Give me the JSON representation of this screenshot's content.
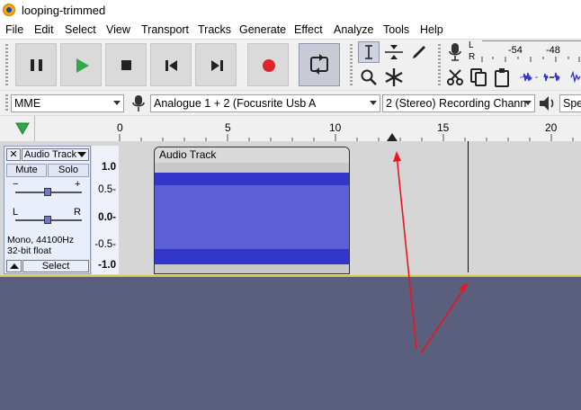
{
  "window": {
    "title": "looping-trimmed"
  },
  "menu": [
    "File",
    "Edit",
    "Select",
    "View",
    "Transport",
    "Tracks",
    "Generate",
    "Effect",
    "Analyze",
    "Tools",
    "Help"
  ],
  "meter": {
    "channels": [
      "L",
      "R"
    ],
    "scale": [
      "-54",
      "-48"
    ]
  },
  "device": {
    "host": "MME",
    "recording_device": "Analogue 1 + 2 (Focusrite Usb A",
    "recording_channels": "2 (Stereo) Recording Chann",
    "playback_device": "Spe"
  },
  "timeline": {
    "ticks": [
      "0",
      "5",
      "10",
      "15",
      "20"
    ]
  },
  "track": {
    "name": "Audio Track",
    "close": "✕",
    "mute": "Mute",
    "solo": "Solo",
    "gain_minus": "−",
    "gain_plus": "+",
    "pan_left": "L",
    "pan_right": "R",
    "info_rate": "Mono, 44100Hz",
    "info_format": "32-bit float",
    "select": "Select",
    "vruler": [
      "1.0",
      "0.5-",
      "0.0-",
      "-0.5-",
      "-1.0"
    ],
    "clip_name": "Audio Track"
  },
  "colors": {
    "waveform_dark": "#3236c9",
    "waveform_light": "#5c60d6",
    "annotation": "#e8161c",
    "empty_area": "#5a5f7e"
  }
}
